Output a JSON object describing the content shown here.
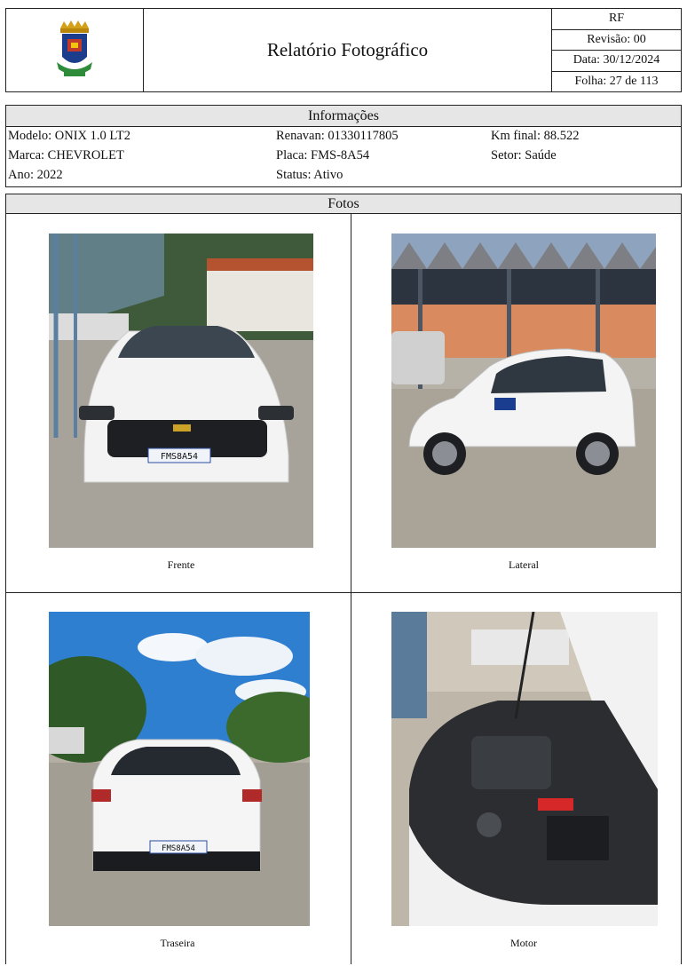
{
  "header": {
    "title": "Relatório Fotográfico",
    "code": "RF",
    "revision": "Revisão: 00",
    "date": "Data: 30/12/2024",
    "sheet": "Folha: 27 de 113"
  },
  "info": {
    "section_title": "Informações",
    "modelo": "Modelo: ONIX 1.0 LT2",
    "marca": "Marca: CHEVROLET",
    "ano": "Ano: 2022",
    "renavan": "Renavan: 01330117805",
    "placa": "Placa: FMS-8A54",
    "status": "Status: Ativo",
    "km_final": "Km final: 88.522",
    "setor": "Setor: Saúde"
  },
  "photos": {
    "section_title": "Fotos",
    "plate_text": "FMS8A54",
    "items": [
      {
        "caption": "Frente"
      },
      {
        "caption": "Lateral"
      },
      {
        "caption": "Traseira"
      },
      {
        "caption": "Motor"
      }
    ]
  }
}
